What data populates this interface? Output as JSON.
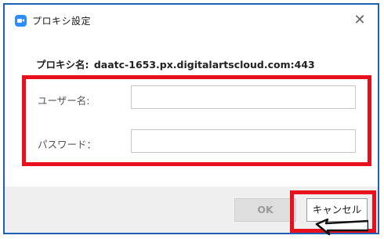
{
  "window": {
    "title": "プロキシ設定",
    "close_glyph": "✕"
  },
  "proxy": {
    "label": "プロキシ名:",
    "value": "daatc-1653.px.digitalartscloud.com:443"
  },
  "form": {
    "username_label": "ユーザー名:",
    "username_value": "",
    "password_label": "パスワード：",
    "password_value": ""
  },
  "buttons": {
    "ok_label": "OK",
    "cancel_label": "キャンセル"
  },
  "icons": {
    "app": "video-camera-icon",
    "close": "close-icon",
    "pointer": "arrow-pointer-icon"
  },
  "colors": {
    "window_border": "#1f5fb5",
    "app_icon": "#2d8cff",
    "highlight": "#e8101c",
    "footer_bg": "#efefef"
  }
}
